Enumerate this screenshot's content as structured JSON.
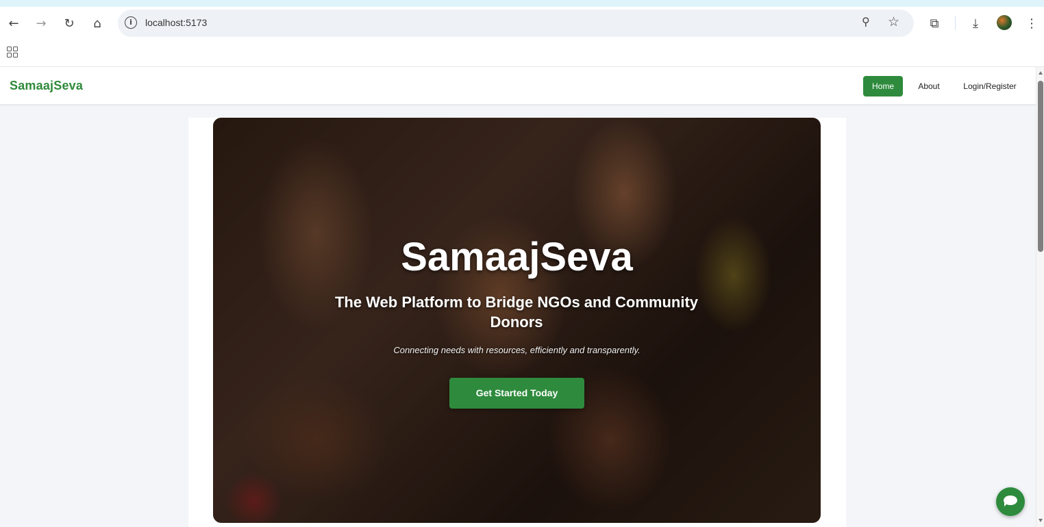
{
  "browser": {
    "url": "localhost:5173",
    "icons": {
      "back": "back-arrow-icon",
      "forward": "forward-arrow-icon",
      "reload": "reload-icon",
      "home": "home-icon",
      "site_info": "info-icon",
      "zoom": "zoom-icon",
      "bookmark": "star-icon",
      "extensions": "puzzle-icon",
      "downloads": "download-icon",
      "profile": "avatar",
      "menu": "more-vertical-icon",
      "apps": "apps-grid-icon"
    }
  },
  "site": {
    "brand": "SamaajSeva",
    "nav": {
      "home": "Home",
      "about": "About",
      "login": "Login/Register"
    }
  },
  "hero": {
    "title": "SamaajSeva",
    "subtitle": "The Web Platform to Bridge NGOs and Community Donors",
    "tagline": "Connecting needs with resources, efficiently and transparently.",
    "cta": "Get Started Today"
  },
  "colors": {
    "brand_green": "#2e8b3d",
    "page_bg": "#f3f5f8",
    "chrome_accent": "#dff3fb"
  }
}
